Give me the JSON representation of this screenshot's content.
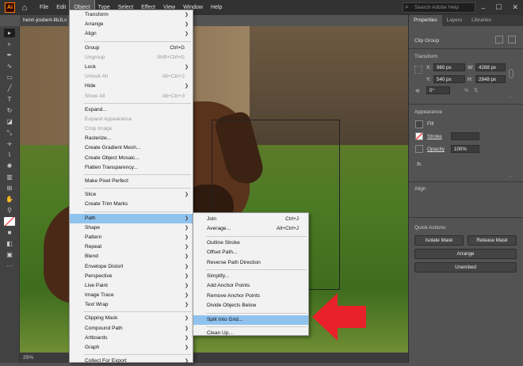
{
  "menubar": {
    "logo": "Ai",
    "items": [
      "File",
      "Edit",
      "Object",
      "Type",
      "Select",
      "Effect",
      "View",
      "Window",
      "Help"
    ],
    "active": "Object",
    "search_placeholder": "Search Adobe Help"
  },
  "document": {
    "tab_title": "henri-joubert-llbJLs",
    "zoom": "25%"
  },
  "object_menu": {
    "items": [
      {
        "label": "Transform",
        "submenu": true
      },
      {
        "label": "Arrange",
        "submenu": true
      },
      {
        "label": "Align",
        "submenu": true
      },
      {
        "sep": true
      },
      {
        "label": "Group",
        "shortcut": "Ctrl+G"
      },
      {
        "label": "Ungroup",
        "shortcut": "Shift+Ctrl+G",
        "disabled": true
      },
      {
        "label": "Lock",
        "submenu": true
      },
      {
        "label": "Unlock All",
        "shortcut": "Alt+Ctrl+2",
        "disabled": true
      },
      {
        "label": "Hide",
        "submenu": true
      },
      {
        "label": "Show All",
        "shortcut": "Alt+Ctrl+3",
        "disabled": true
      },
      {
        "sep": true
      },
      {
        "label": "Expand..."
      },
      {
        "label": "Expand Appearance",
        "disabled": true
      },
      {
        "label": "Crop Image",
        "disabled": true
      },
      {
        "label": "Rasterize..."
      },
      {
        "label": "Create Gradient Mesh..."
      },
      {
        "label": "Create Object Mosaic..."
      },
      {
        "label": "Flatten Transparency..."
      },
      {
        "sep": true
      },
      {
        "label": "Make Pixel Perfect"
      },
      {
        "sep": true
      },
      {
        "label": "Slice",
        "submenu": true
      },
      {
        "label": "Create Trim Marks"
      },
      {
        "sep": true
      },
      {
        "label": "Path",
        "submenu": true,
        "highlight": true
      },
      {
        "label": "Shape",
        "submenu": true
      },
      {
        "label": "Pattern",
        "submenu": true
      },
      {
        "label": "Repeat",
        "submenu": true
      },
      {
        "label": "Blend",
        "submenu": true
      },
      {
        "label": "Envelope Distort",
        "submenu": true
      },
      {
        "label": "Perspective",
        "submenu": true
      },
      {
        "label": "Live Paint",
        "submenu": true
      },
      {
        "label": "Image Trace",
        "submenu": true
      },
      {
        "label": "Text Wrap",
        "submenu": true
      },
      {
        "sep": true
      },
      {
        "label": "Clipping Mask",
        "submenu": true
      },
      {
        "label": "Compound Path",
        "submenu": true
      },
      {
        "label": "Artboards",
        "submenu": true
      },
      {
        "label": "Graph",
        "submenu": true
      },
      {
        "sep": true
      },
      {
        "label": "Collect For Export",
        "submenu": true
      }
    ]
  },
  "path_submenu": {
    "items": [
      {
        "label": "Join",
        "shortcut": "Ctrl+J"
      },
      {
        "label": "Average...",
        "shortcut": "Alt+Ctrl+J"
      },
      {
        "sep": true
      },
      {
        "label": "Outline Stroke"
      },
      {
        "label": "Offset Path..."
      },
      {
        "label": "Reverse Path Direction"
      },
      {
        "sep": true
      },
      {
        "label": "Simplify..."
      },
      {
        "label": "Add Anchor Points"
      },
      {
        "label": "Remove Anchor Points"
      },
      {
        "label": "Divide Objects Below"
      },
      {
        "sep": true
      },
      {
        "label": "Split Into Grid...",
        "highlight": true
      },
      {
        "sep": true
      },
      {
        "label": "Clean Up..."
      }
    ]
  },
  "properties_panel": {
    "tabs": [
      "Properties",
      "Layers",
      "Libraries"
    ],
    "object_type": "Clip Group",
    "transform_header": "Transform",
    "x_label": "X:",
    "x_value": "960 px",
    "y_label": "Y:",
    "y_value": "540 px",
    "w_label": "W:",
    "w_value": "4288 px",
    "h_label": "H:",
    "h_value": "2848 px",
    "rotation": "0°",
    "appearance_header": "Appearance",
    "fill_label": "Fill",
    "stroke_label": "Stroke",
    "opacity_label": "Opacity",
    "opacity_value": "100%",
    "fx_label": "fx.",
    "align_header": "Align",
    "quick_actions_header": "Quick Actions",
    "btn_isolate": "Isolate Mask",
    "btn_release": "Release Mask",
    "btn_arrange": "Arrange",
    "btn_unembed": "Unembed"
  },
  "colors": {
    "highlight": "#90c2ee",
    "arrow": "#e8212a",
    "chrome": "#323232"
  }
}
